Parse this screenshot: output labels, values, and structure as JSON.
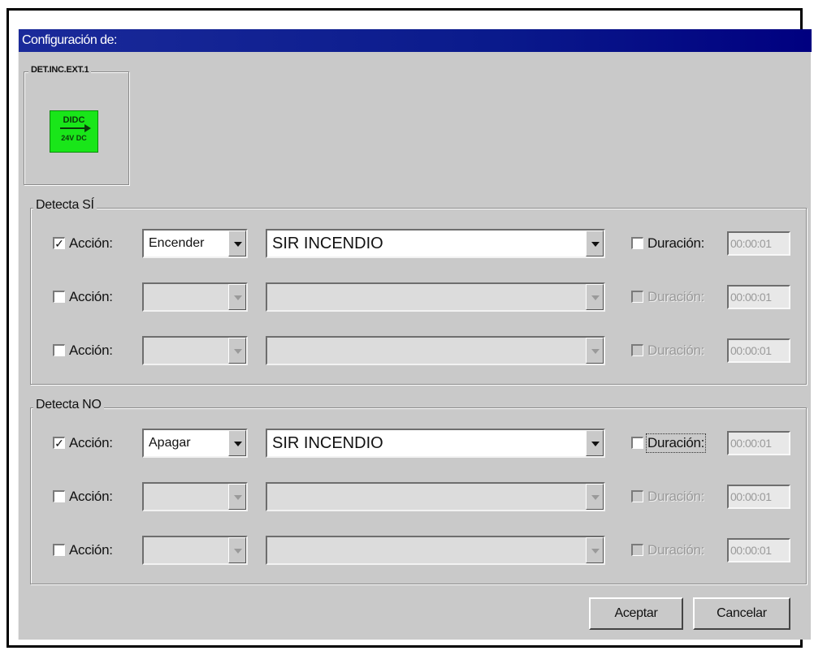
{
  "dialog": {
    "title": "Configuración de:",
    "device_group": "DET.INC.EXT.1",
    "device_icon": {
      "top": "DIDC",
      "bottom": "24V DC",
      "color": "#19e619"
    }
  },
  "detecta_si": {
    "legend": "Detecta SÍ",
    "rows": [
      {
        "checked": true,
        "enabled": true,
        "accion_label": "Acción:",
        "action": "Encender",
        "target": "SIR  INCENDIO",
        "duracion_checked": false,
        "duracion_label": "Duración:",
        "duracion_value": "00:00:01"
      },
      {
        "checked": false,
        "enabled": false,
        "accion_label": "Acción:",
        "action": "",
        "target": "",
        "duracion_checked": false,
        "duracion_label": "Duración:",
        "duracion_value": "00:00:01"
      },
      {
        "checked": false,
        "enabled": false,
        "accion_label": "Acción:",
        "action": "",
        "target": "",
        "duracion_checked": false,
        "duracion_label": "Duración:",
        "duracion_value": "00:00:01"
      }
    ]
  },
  "detecta_no": {
    "legend": "Detecta NO",
    "rows": [
      {
        "checked": true,
        "enabled": true,
        "accion_label": "Acción:",
        "action": "Apagar",
        "target": "SIR  INCENDIO",
        "duracion_checked": false,
        "duracion_label": "Duración:",
        "duracion_value": "00:00:01"
      },
      {
        "checked": false,
        "enabled": false,
        "accion_label": "Acción:",
        "action": "",
        "target": "",
        "duracion_checked": false,
        "duracion_label": "Duración:",
        "duracion_value": "00:00:01"
      },
      {
        "checked": false,
        "enabled": false,
        "accion_label": "Acción:",
        "action": "",
        "target": "",
        "duracion_checked": false,
        "duracion_label": "Duración:",
        "duracion_value": "00:00:01"
      }
    ]
  },
  "buttons": {
    "ok": "Aceptar",
    "cancel": "Cancelar"
  }
}
